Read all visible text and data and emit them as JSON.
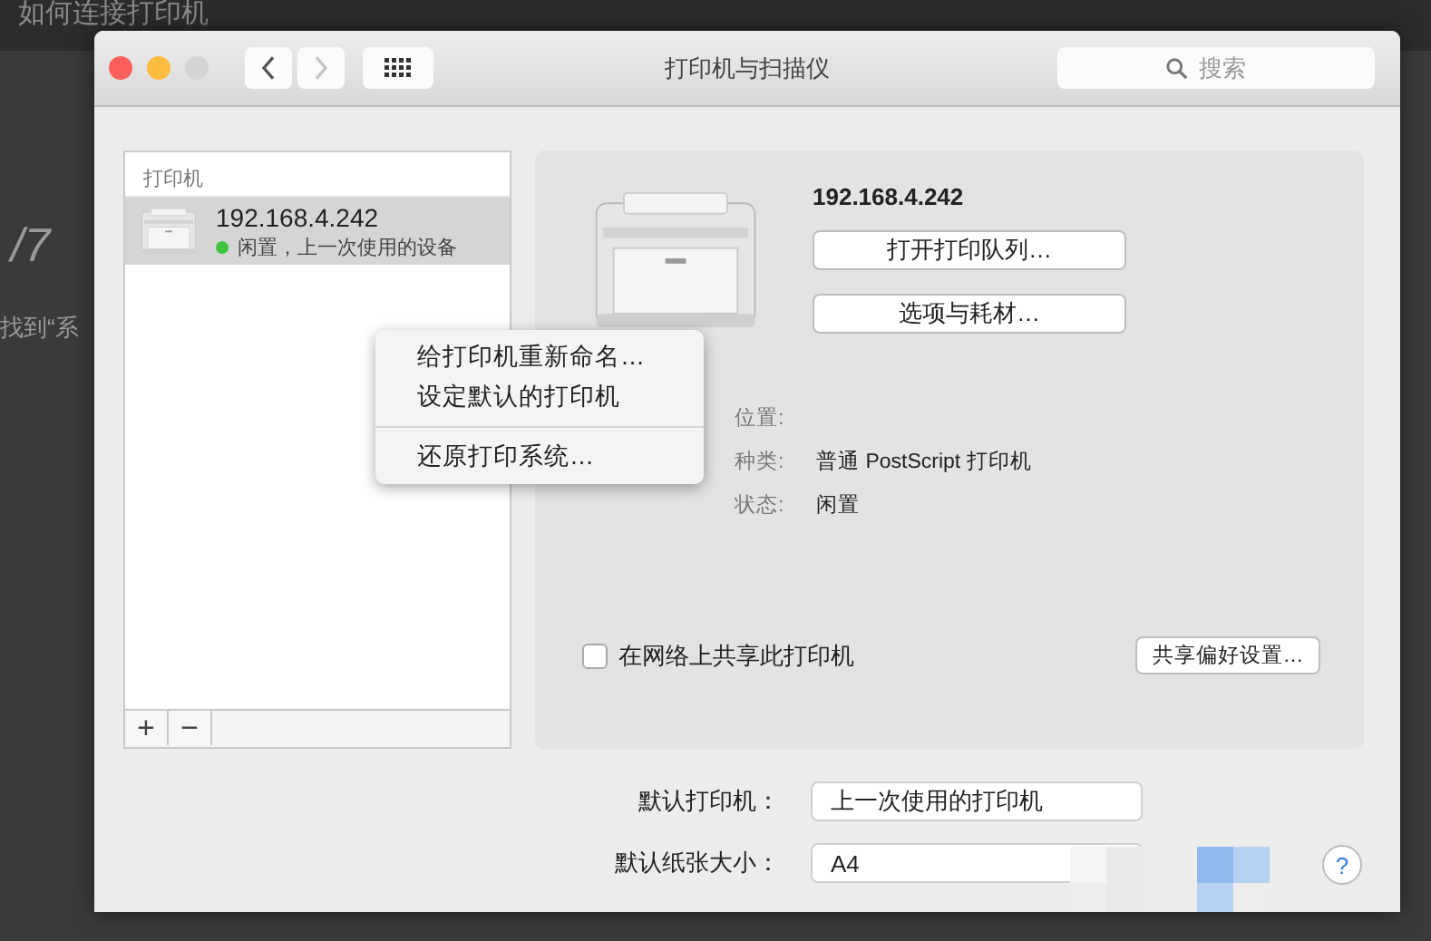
{
  "background_page": {
    "heading": "如何连接打印机",
    "side_texts": [
      "/7",
      "找到“系"
    ]
  },
  "window": {
    "title": "打印机与扫描仪",
    "traffic_lights": [
      {
        "color": "#fc605c"
      },
      {
        "color": "#fdbc40"
      },
      {
        "color": "#d4d4d4"
      }
    ],
    "nav_buttons": [
      {
        "kind": "back",
        "disabled": false
      },
      {
        "kind": "forward",
        "disabled": true
      }
    ],
    "search": {
      "placeholder": "搜索"
    }
  },
  "printer_list": {
    "header": "打印机",
    "items": [
      {
        "name": "192.168.4.242",
        "status": "闲置，上一次使用的设备",
        "color": "#3ec43e",
        "selected": true
      }
    ],
    "add_button": "+",
    "remove_button": "−"
  },
  "context_menu": {
    "groups": [
      [
        "给打印机重新命名…",
        "设定默认的打印机"
      ],
      [
        "还原打印系统…"
      ]
    ]
  },
  "printer_detail": {
    "name": "192.168.4.242",
    "buttons": [
      "打开打印队列…",
      "选项与耗材…"
    ],
    "info": [
      {
        "label": "位置:"
      },
      {
        "label": "种类:",
        "value": "普通 PostScript 打印机"
      },
      {
        "label": "状态:",
        "value": "闲置"
      }
    ],
    "share": {
      "label": "在网络上共享此打印机",
      "checked": false
    },
    "share_prefs_button": "共享偏好设置…"
  },
  "defaults": [
    {
      "label": "默认打印机：",
      "value": "上一次使用的打印机"
    },
    {
      "label": "默认纸张大小：",
      "value": "A4"
    }
  ],
  "help_button": "?"
}
